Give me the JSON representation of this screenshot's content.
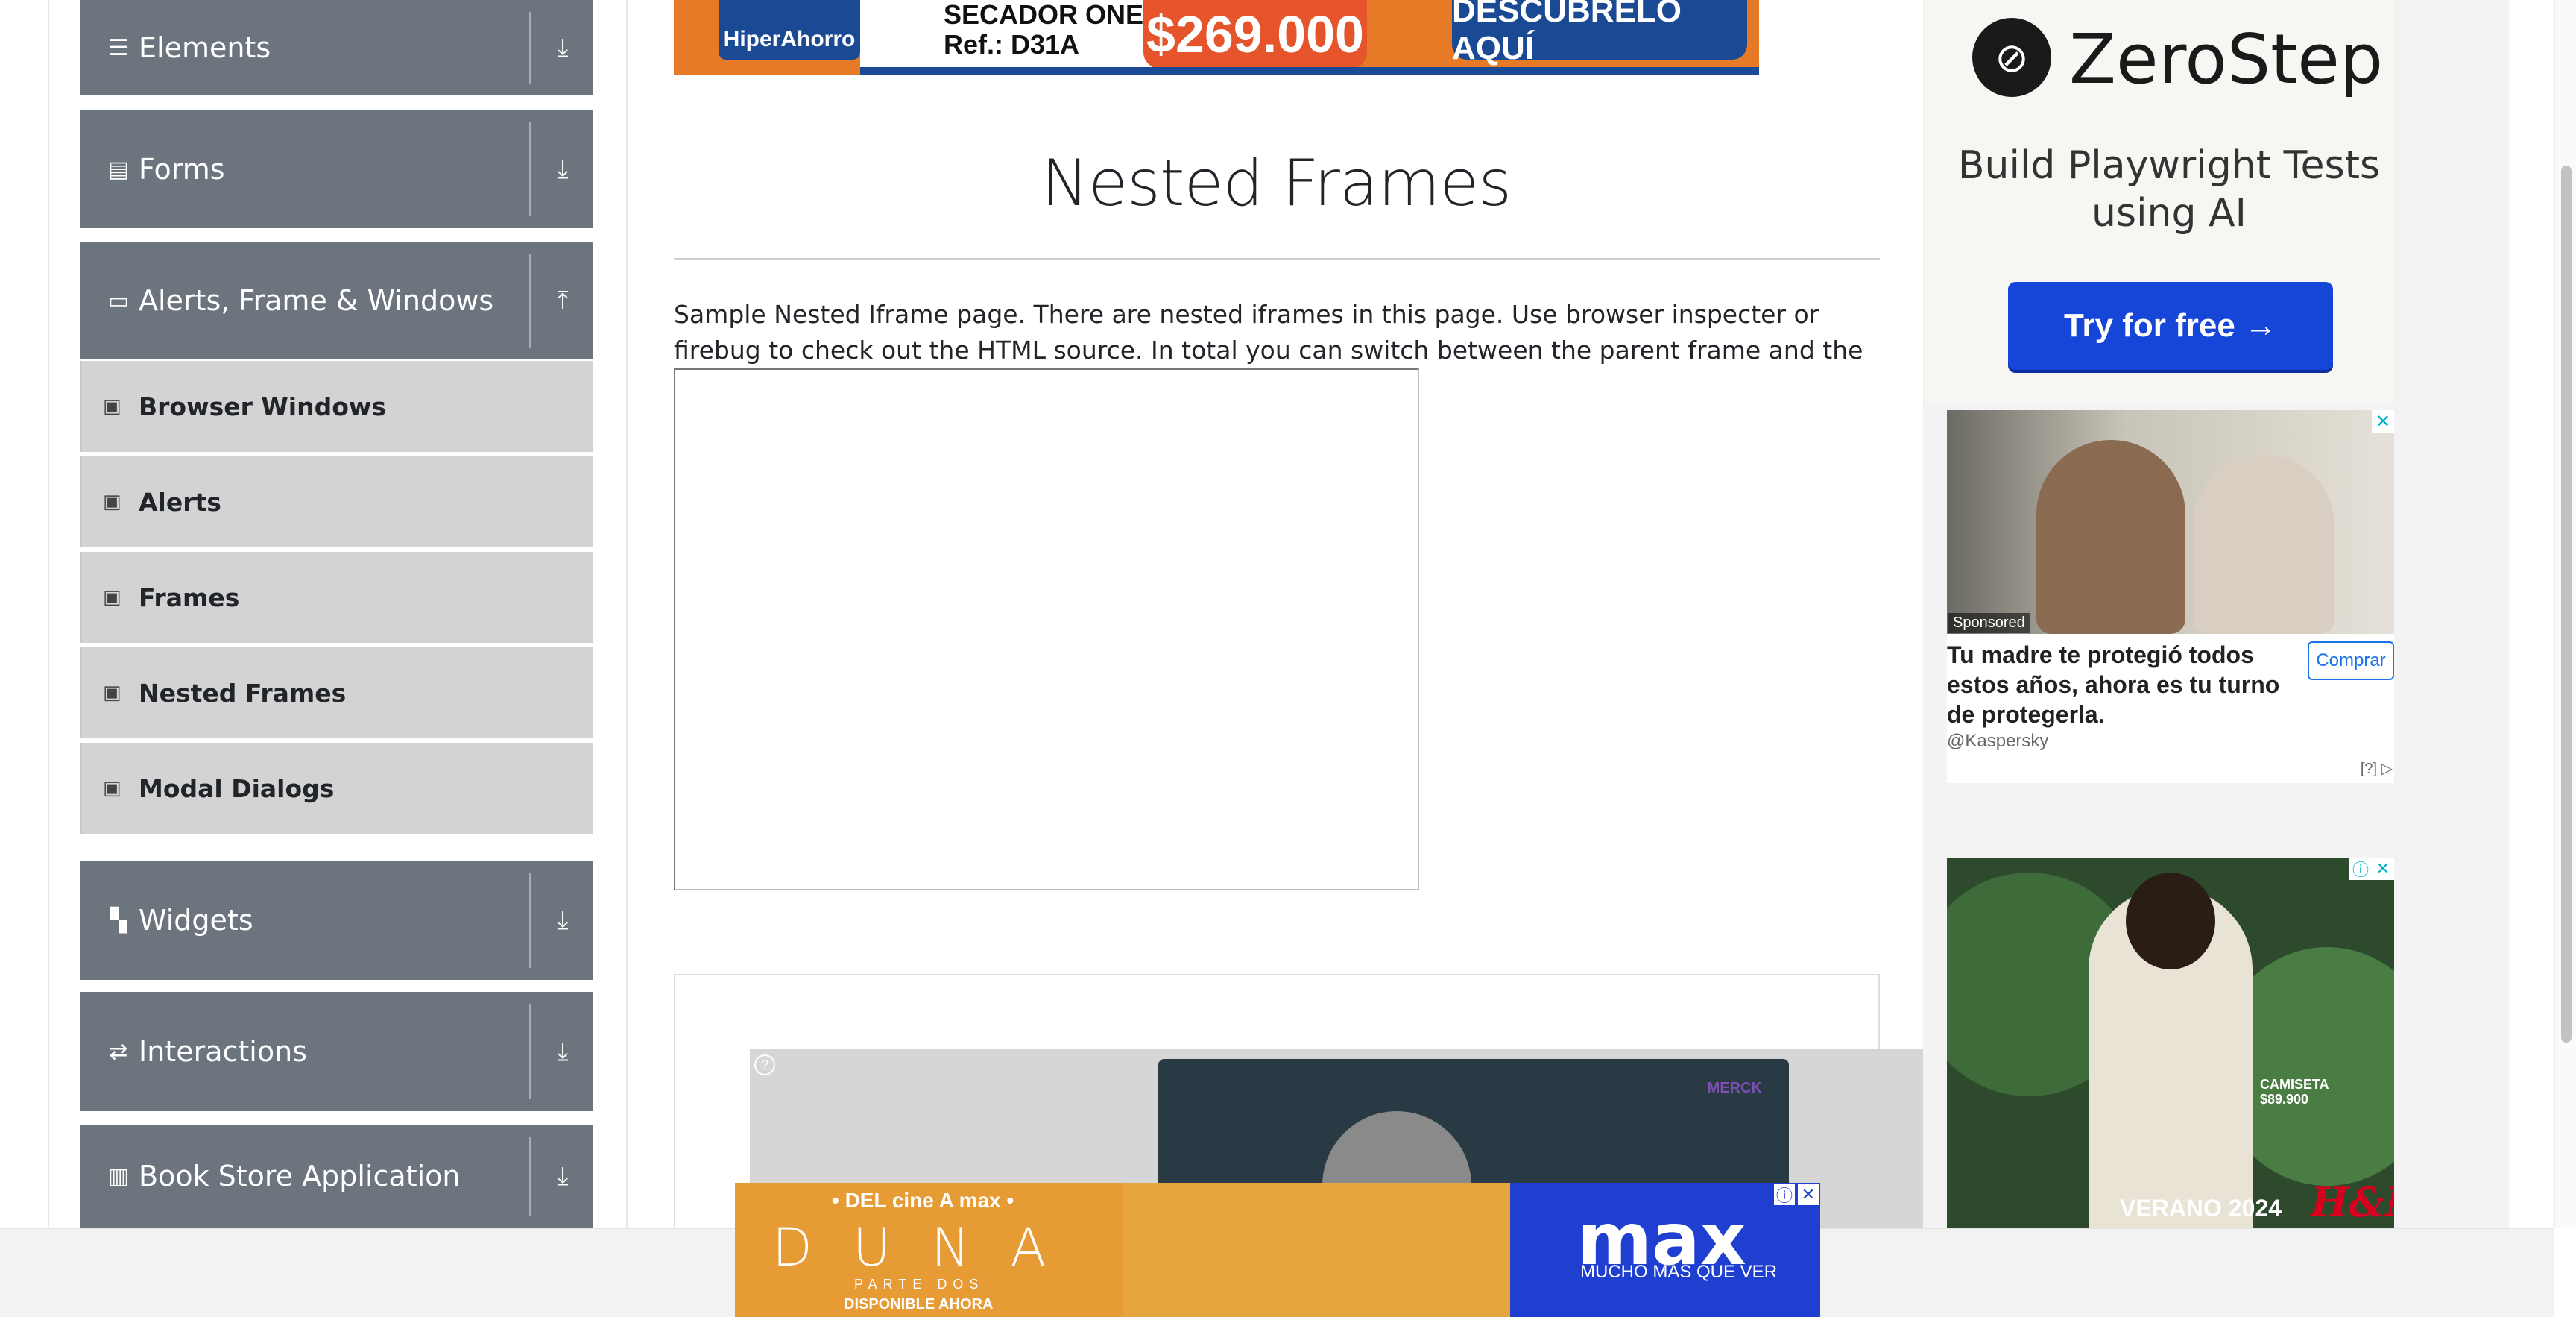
{
  "sidebar": {
    "groups": [
      {
        "label": "Elements",
        "icon": "list-icon",
        "arrow": "download-arrow-icon"
      },
      {
        "label": "Forms",
        "icon": "form-icon",
        "arrow": "download-arrow-icon"
      },
      {
        "label": "Alerts, Frame & Windows",
        "icon": "window-icon",
        "arrow": "upload-arrow-icon"
      },
      {
        "label": "Widgets",
        "icon": "widgets-icon",
        "arrow": "download-arrow-icon"
      },
      {
        "label": "Interactions",
        "icon": "interactions-icon",
        "arrow": "download-arrow-icon"
      },
      {
        "label": "Book Store Application",
        "icon": "bookstore-icon",
        "arrow": "download-arrow-icon"
      }
    ],
    "items": [
      {
        "label": "Browser Windows"
      },
      {
        "label": "Alerts"
      },
      {
        "label": "Frames"
      },
      {
        "label": "Nested Frames"
      },
      {
        "label": "Modal Dialogs"
      }
    ]
  },
  "top_banner": {
    "brand": "HiperAhorro",
    "product": "SECADOR ONE",
    "ref": "Ref.: D31A",
    "price": "$269.000",
    "cta": "DESCÚBRELO AQUÍ"
  },
  "main": {
    "title": "Nested Frames",
    "description": "Sample Nested Iframe page. There are nested iframes in this page. Use browser inspecter or firebug to check out the HTML source. In total you can switch between the parent frame and the nested child frame."
  },
  "bottom_ad": {
    "tagline": "• DEL cine A max •",
    "movie": "DUNA",
    "subtitle": "PARTE DOS",
    "availability": "DISPONIBLE AHORA",
    "brand": "max",
    "slogan": "MUCHO MÁS QUE VER"
  },
  "right_ads": {
    "zerostep": {
      "name": "ZeroStep",
      "tagline": "Build Playwright Tests using AI",
      "button": "Try for free →"
    },
    "kaspersky": {
      "sponsored": "Sponsored",
      "headline": "Tu madre te protegió todos estos años, ahora es tu turno de protegerla.",
      "button": "Comprar",
      "advertiser": "@Kaspersky",
      "adchoices": "[?]"
    },
    "hm": {
      "product": "CAMISETA",
      "price": "$89.900",
      "campaign": "VERANO 2024",
      "brand": "H&M"
    }
  },
  "colors": {
    "sidebar_group_bg": "#6c757d",
    "sidebar_item_bg": "#d3d3d3",
    "cta_blue": "#1546d8",
    "max_blue": "#1e3fd0"
  }
}
